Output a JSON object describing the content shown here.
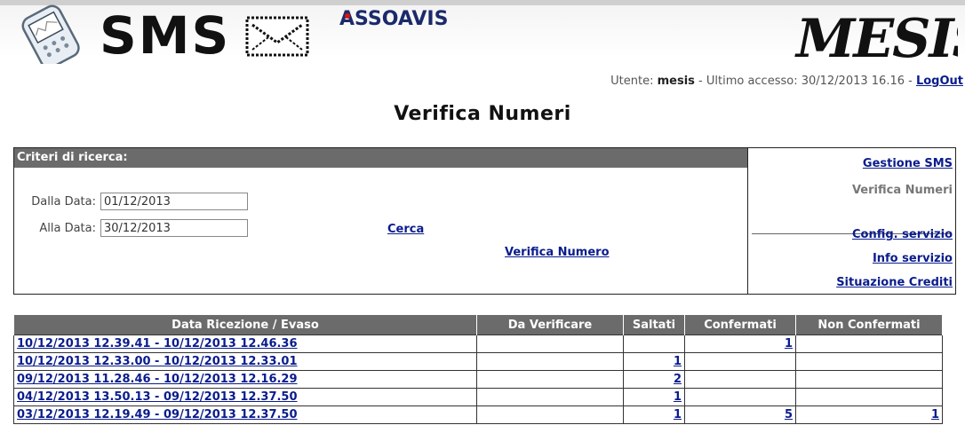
{
  "header": {
    "sms_logo": "SMS",
    "asso_logo": "ASSOAVIS",
    "mesis_logo": "MESIS"
  },
  "user_bar": {
    "user_label": "Utente:",
    "username": "mesis",
    "access_label": "- Ultimo accesso: 30/12/2013 16.16 -",
    "logout": "LogOut"
  },
  "page_title": "Verifica Numeri",
  "search": {
    "header": "Criteri di ricerca:",
    "from_label": "Dalla Data:",
    "from_value": "01/12/2013",
    "to_label": "Alla Data:",
    "to_value": "30/12/2013",
    "search_link": "Cerca",
    "verify_link": "Verifica Numero"
  },
  "nav": {
    "gestione_sms": "Gestione SMS",
    "verifica_numeri": "Verifica Numeri",
    "config_servizio": "Config. servizio",
    "info_servizio": "Info servizio",
    "situazione_crediti": "Situazione Crediti"
  },
  "table": {
    "headers": [
      "Data Ricezione / Evaso",
      "Da Verificare",
      "Saltati",
      "Confermati",
      "Non Confermati"
    ],
    "rows": [
      {
        "date": "10/12/2013 12.39.41 - 10/12/2013 12.46.36",
        "da_verificare": "",
        "saltati": "",
        "confermati": "1",
        "non_confermati": ""
      },
      {
        "date": "10/12/2013 12.33.00 - 10/12/2013 12.33.01",
        "da_verificare": "",
        "saltati": "1",
        "confermati": "",
        "non_confermati": ""
      },
      {
        "date": "09/12/2013 11.28.46 - 10/12/2013 12.16.29",
        "da_verificare": "",
        "saltati": "2",
        "confermati": "",
        "non_confermati": ""
      },
      {
        "date": "04/12/2013 13.50.13 - 09/12/2013 12.37.50",
        "da_verificare": "",
        "saltati": "1",
        "confermati": "",
        "non_confermati": ""
      },
      {
        "date": "03/12/2013 12.19.49 - 09/12/2013 12.37.50",
        "da_verificare": "",
        "saltati": "1",
        "confermati": "5",
        "non_confermati": "1"
      }
    ]
  }
}
